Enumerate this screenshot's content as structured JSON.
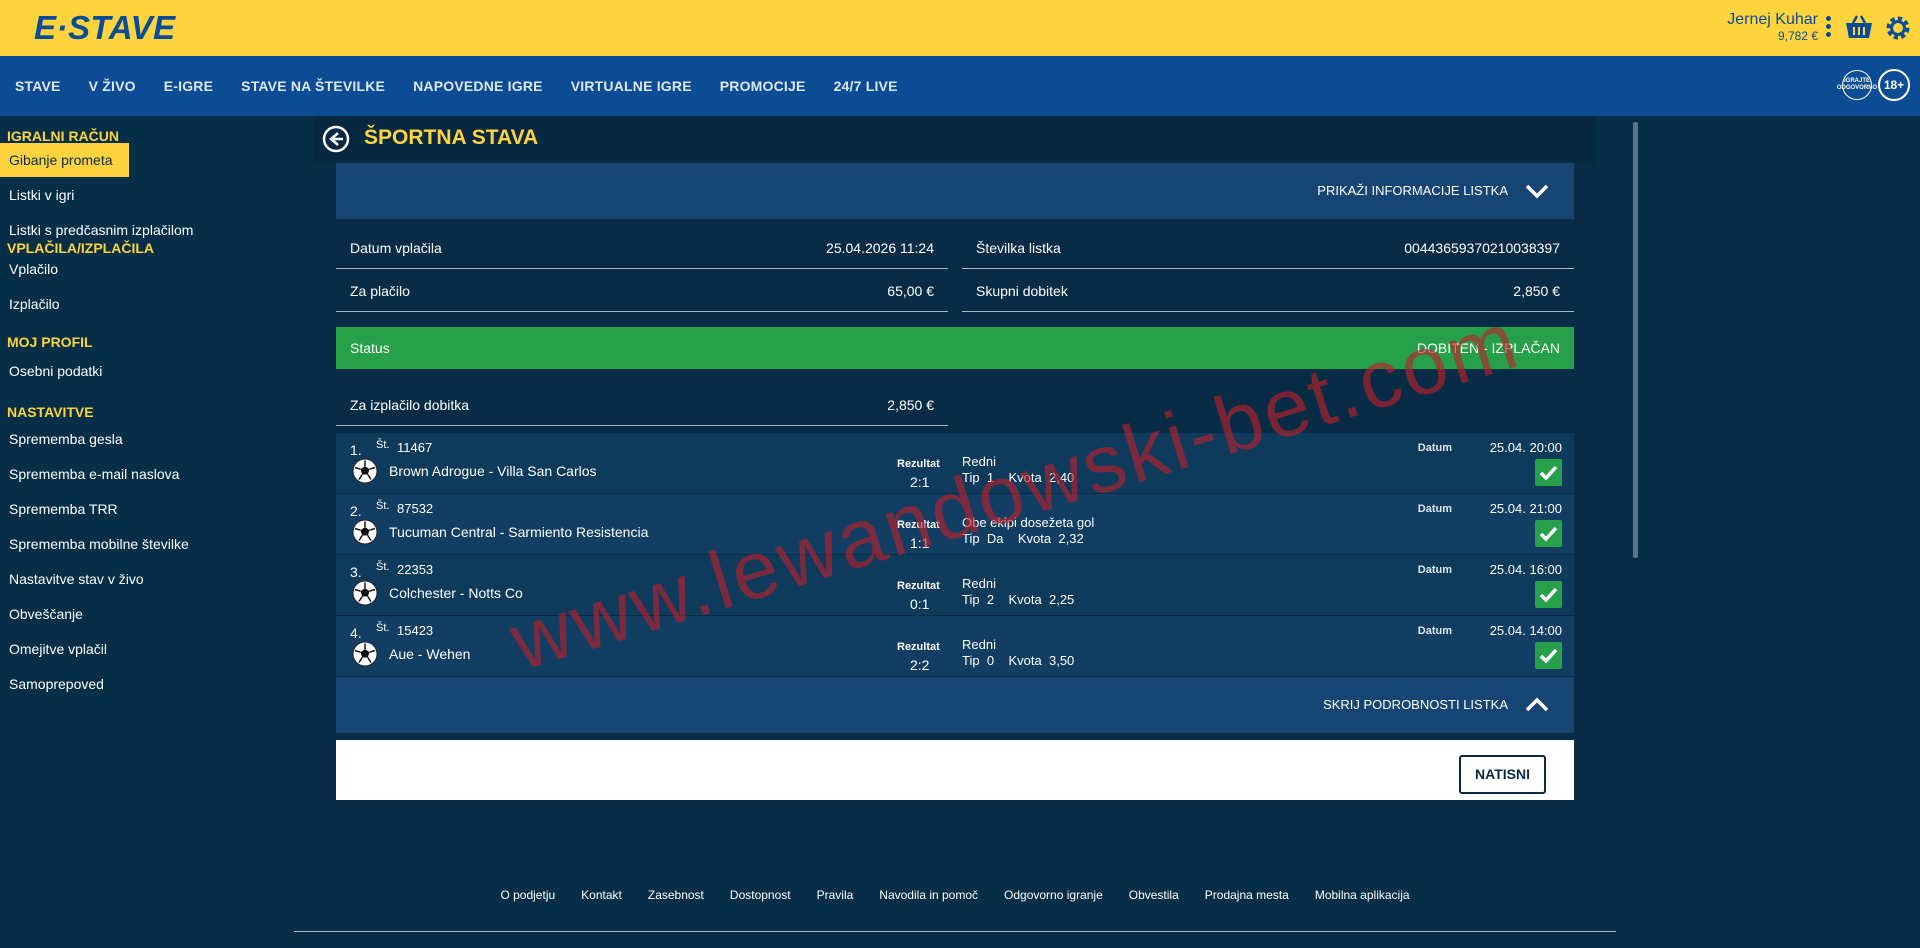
{
  "brand": {
    "logo": "E·STAVE"
  },
  "user": {
    "name": "Jernej Kuhar",
    "balance": "9,782 €"
  },
  "nav": {
    "items": [
      "STAVE",
      "V ŽIVO",
      "E-IGRE",
      "STAVE NA ŠTEVILKE",
      "NAPOVEDNE IGRE",
      "VIRTUALNE IGRE",
      "PROMOCIJE",
      "24/7 LIVE"
    ],
    "badge_responsible": "IGRAJTE ODGOVORNO",
    "badge_age": "18+"
  },
  "sidebar": {
    "sections": [
      {
        "title": "IGRALNI RAČUN",
        "items": [
          "Gibanje prometa",
          "Listki v igri",
          "Listki s predčasnim izplačilom"
        ]
      },
      {
        "title": "VPLAČILA/IZPLAČILA",
        "items": [
          "Vplačilo",
          "Izplačilo"
        ]
      },
      {
        "title": "MOJ PROFIL",
        "items": [
          "Osebni podatki"
        ]
      },
      {
        "title": "NASTAVITVE",
        "items": [
          "Sprememba gesla",
          "Sprememba e-mail naslova",
          "Sprememba TRR",
          "Sprememba mobilne številke",
          "Nastavitve stav v živo",
          "Obveščanje",
          "Omejitve vplačil",
          "Samoprepoved"
        ]
      }
    ]
  },
  "page": {
    "title": "ŠPORTNA STAVA",
    "show_info": "PRIKAŽI INFORMACIJE LISTKA",
    "hide_details": "SKRIJ PODROBNOSTI LISTKA",
    "print": "NATISNI"
  },
  "ticket": {
    "date_label": "Datum vplačila",
    "date_value": "25.04.2026 11:24",
    "number_label": "Številka listka",
    "number_value": "0044365937021003839​7",
    "pay_label": "Za plačilo",
    "pay_value": "65,00 €",
    "win_label": "Skupni dobitek",
    "win_value": "2,850 €",
    "status_label": "Status",
    "status_value": "DOBITEN - IZPLAČAN",
    "payout_label": "Za izplačilo dobitka",
    "payout_value": "2,850 €"
  },
  "events_labels": {
    "st": "Št.",
    "result": "Rezultat",
    "date": "Datum",
    "tip": "Tip",
    "odds": "Kvota"
  },
  "events": [
    {
      "num": "1.",
      "id": "11467",
      "match": "Brown Adrogue - Villa San Carlos",
      "result": "2:1",
      "bet": "Redni",
      "tip": "1",
      "odds": "2,40",
      "date": "25.04. 20:00"
    },
    {
      "num": "2.",
      "id": "87532",
      "match": "Tucuman Central - Sarmiento Resistencia",
      "result": "1:1",
      "bet": "Obe ekipi dosežeta gol",
      "tip": "Da",
      "odds": "2,32",
      "date": "25.04. 21:00"
    },
    {
      "num": "3.",
      "id": "22353",
      "match": "Colchester - Notts Co",
      "result": "0:1",
      "bet": "Redni",
      "tip": "2",
      "odds": "2,25",
      "date": "25.04. 16:00"
    },
    {
      "num": "4.",
      "id": "15423",
      "match": "Aue - Wehen",
      "result": "2:2",
      "bet": "Redni",
      "tip": "0",
      "odds": "3,50",
      "date": "25.04. 14:00"
    }
  ],
  "footer": [
    "O podjetju",
    "Kontakt",
    "Zasebnost",
    "Dostopnost",
    "Pravila",
    "Navodila in pomoč",
    "Odgovorno igranje",
    "Obvestila",
    "Prodajna mesta",
    "Mobilna aplikacija"
  ],
  "watermark": "www.lewandowski-bet.com"
}
